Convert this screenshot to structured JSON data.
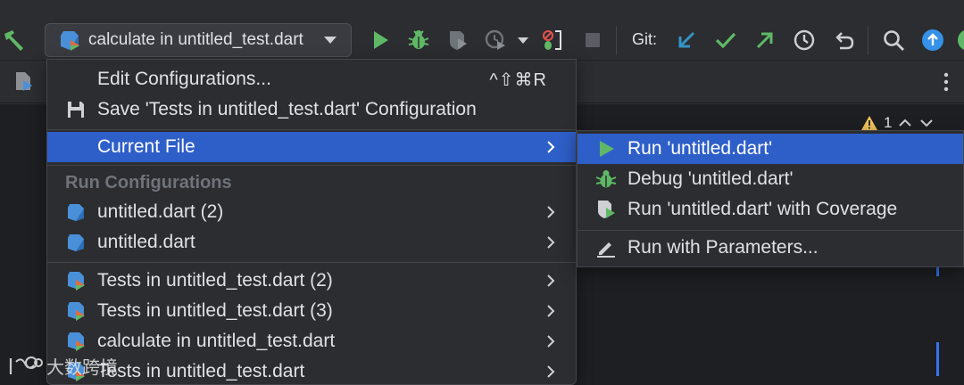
{
  "toolbar": {
    "run_config_label": "calculate in untitled_test.dart",
    "git_label": "Git:"
  },
  "editor": {
    "warning_count": "1"
  },
  "menu": {
    "edit_configurations": {
      "label": "Edit Configurations...",
      "shortcut": "^⇧⌘R"
    },
    "save_configuration": {
      "label": "Save 'Tests in untitled_test.dart' Configuration"
    },
    "current_file": {
      "label": "Current File"
    },
    "run_configurations_header": "Run Configurations",
    "run_configurations": [
      {
        "label": "untitled.dart (2)"
      },
      {
        "label": "untitled.dart"
      }
    ],
    "test_configurations": [
      {
        "label": "Tests in untitled_test.dart (2)"
      },
      {
        "label": "Tests in untitled_test.dart (3)"
      },
      {
        "label": "calculate in untitled_test.dart"
      },
      {
        "label": "Tests in untitled_test.dart"
      }
    ]
  },
  "submenu": {
    "items": [
      {
        "label": "Run 'untitled.dart'"
      },
      {
        "label": "Debug 'untitled.dart'"
      },
      {
        "label": "Run 'untitled.dart' with Coverage"
      },
      {
        "label": "Run with Parameters..."
      }
    ]
  },
  "watermark": {
    "text": "大数跨境"
  },
  "colors": {
    "selection": "#2e5fc8",
    "run_green": "#5fb865",
    "git_blue": "#3592c4",
    "update_blue": "#3592e8",
    "warning_yellow": "#f2c55c"
  }
}
